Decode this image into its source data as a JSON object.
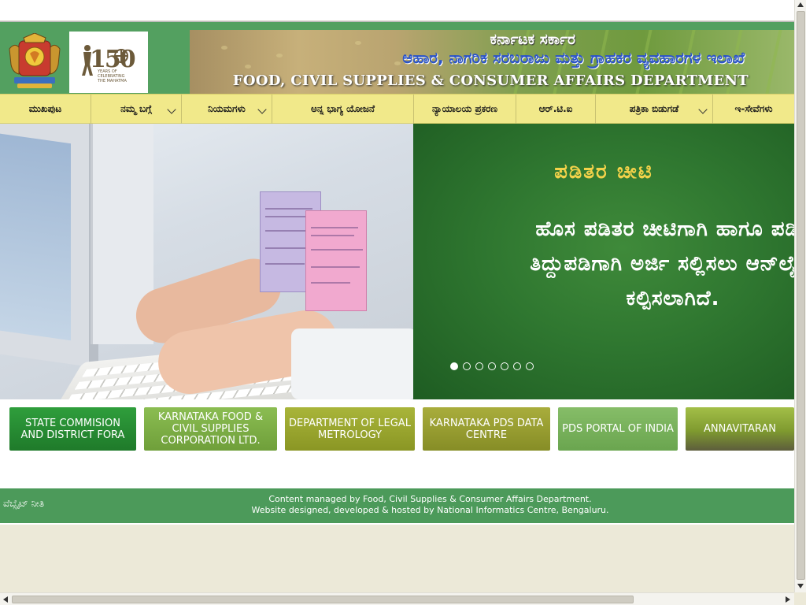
{
  "header": {
    "emblem_name": "karnataka-emblem",
    "logo_150": {
      "number": "150",
      "caption": "YEARS OF CELEBRATING THE MAHATMA"
    },
    "banner_kannada_1": "ಕರ್ನಾಟಕ ಸರ್ಕಾರ",
    "banner_kannada_2": "ಆಹಾರ, ನಾಗರಿಕ ಸರಬರಾಜು ಮತ್ತು ಗ್ರಾಹಕರ ವ್ಯವಹಾರಗಳ ಇಲಾಖೆ",
    "banner_english": "FOOD, CIVIL SUPPLIES & CONSUMER AFFAIRS DEPARTMENT"
  },
  "nav": {
    "items": [
      {
        "label": "ಮುಖಪುಟ",
        "dropdown": false
      },
      {
        "label": "ನಮ್ಮ ಬಗ್ಗೆ",
        "dropdown": true
      },
      {
        "label": "ನಿಯಮಗಳು",
        "dropdown": true
      },
      {
        "label": "ಅನ್ನ ಭಾಗ್ಯ ಯೋಜನೆ",
        "dropdown": false
      },
      {
        "label": "ನ್ಯಾಯಾಲಯ ಪ್ರಕರಣ",
        "dropdown": false
      },
      {
        "label": "ಆರ್.ಟಿ.ಐ",
        "dropdown": false
      },
      {
        "label": "ಪತ್ರಿಕಾ ಬಿಡುಗಡೆ",
        "dropdown": true
      },
      {
        "label": "ಇ-ಸೇವೆಗಳು",
        "dropdown": false
      }
    ]
  },
  "slider": {
    "title": "ಪಡಿತರ ಚೀಟಿ",
    "body_lines": [
      "ಹೊಸ ಪಡಿತರ ಚೀಟಿಗಾಗಿ ಹಾಗೂ ಪಡಿತ",
      "ತಿದ್ದುಪಡಿಗಾಗಿ ಅರ್ಜಿ ಸಲ್ಲಿಸಲು ಆನ್‌ಲೈನ್",
      "ಕಲ್ಪಿಸಲಾಗಿದೆ."
    ],
    "dot_count": 7,
    "active_dot": 0
  },
  "links": [
    {
      "label": "STATE COMMISION AND DISTRICT FORA",
      "color": "#2e8b3a"
    },
    {
      "label": "KARNATAKA FOOD & CIVIL SUPPLIES CORPORATION LTD.",
      "color": "#7fae47"
    },
    {
      "label": "DEPARTMENT OF LEGAL METROLOGY",
      "color": "#9aa82b"
    },
    {
      "label": "KARNATAKA PDS DATA CENTRE",
      "color": "#9aa233"
    },
    {
      "label": "PDS PORTAL OF INDIA",
      "color": "#79b35c"
    },
    {
      "label": "ANNAVITARAN",
      "color": "#8aa83a"
    }
  ],
  "footer": {
    "policy_link": "ವೆಬ್ಸೈಟ್ ನೀತಿ",
    "line1": "Content managed by Food, Civil Supplies & Consumer Affairs Department.",
    "line2": "Website designed, developed & hosted by National Informatics Centre, Bengaluru."
  }
}
